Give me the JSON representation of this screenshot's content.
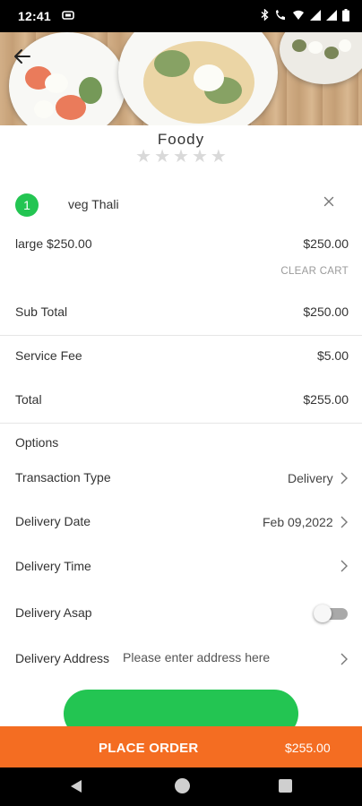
{
  "status_bar": {
    "time": "12:41",
    "notification_icon": "app-notification-icon",
    "icons": [
      "bluetooth-icon",
      "wifi-calling-icon",
      "data-icon",
      "signal-icon",
      "signal-icon",
      "battery-icon"
    ]
  },
  "store": {
    "name": "Foody",
    "rating_stars": 0,
    "max_stars": 5
  },
  "cart_item": {
    "quantity": "1",
    "name": "veg Thali",
    "remove_icon": "close-icon",
    "variant": "large $250.00",
    "price": "$250.00"
  },
  "clear_cart_label": "CLEAR CART",
  "summary": {
    "subtotal_label": "Sub Total",
    "subtotal_value": "$250.00",
    "service_fee_label": "Service Fee",
    "service_fee_value": "$5.00",
    "total_label": "Total",
    "total_value": "$255.00"
  },
  "options": {
    "heading": "Options",
    "transaction_type_label": "Transaction Type",
    "transaction_type_value": "Delivery",
    "delivery_date_label": "Delivery Date",
    "delivery_date_value": "Feb 09,2022",
    "delivery_time_label": "Delivery Time",
    "delivery_asap_label": "Delivery Asap",
    "delivery_asap_on": false,
    "delivery_address_label": "Delivery Address",
    "delivery_address_placeholder": "Please enter address here"
  },
  "place_order": {
    "label": "PLACE ORDER",
    "amount": "$255.00"
  },
  "colors": {
    "accent_green": "#23c552",
    "order_bar_orange": "#f46d22"
  }
}
